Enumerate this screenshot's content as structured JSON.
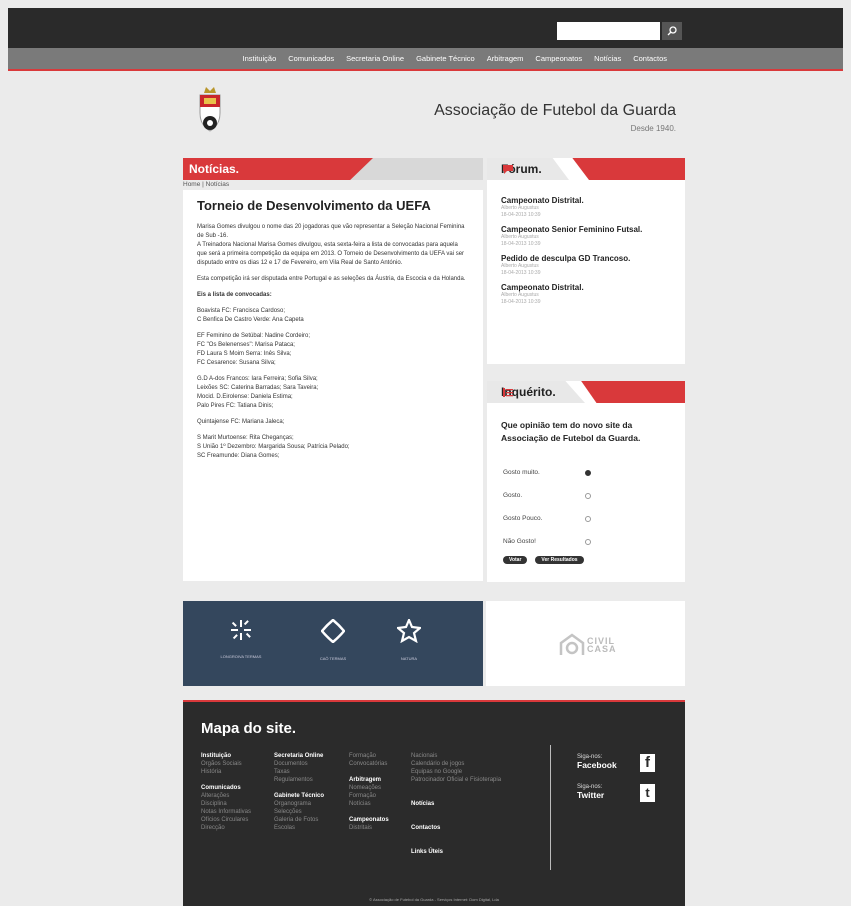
{
  "search": {
    "placeholder": ""
  },
  "nav": [
    "Instituição",
    "Comunicados",
    "Secretaria Online",
    "Gabinete Técnico",
    "Arbitragem",
    "Campeonatos",
    "Notícias",
    "Contactos"
  ],
  "header": {
    "title": "Associação de Futebol da Guarda",
    "subtitle": "Desde 1940."
  },
  "news": {
    "heading": "Notícias.",
    "breadcrumb": "Home | Notícias",
    "article_title": "Torneio de Desenvolvimento da UEFA",
    "paragraphs": [
      "Marisa Gomes divulgou o nome das 20 jogadoras que vão representar a Seleção Nacional Feminina de Sub -16.\nA Treinadora Nacional Marisa Gomes divulgou, esta sexta-feira a lista de convocadas para aquela que será a primeira competição da equipa em 2013. O Torneio de Desenvolvimento da UEFA vai ser disputado entre os dias 12 e 17 de Fevereiro, em Vila Real de Santo António.",
      "Esta competição irá ser disputada entre Portugal e as seleções da Áustria, da Escocia e da Holanda.",
      "Eis a lista de convocadas:",
      "Boavista FC: Francisca Cardoso;\nC Benfica De Castro Verde: Ana Capeta",
      "EF Feminino de Setúbal: Nadine Cordeiro;\nFC \"Os Belenenses\": Marisa Pataca;\nFD Laura S Moim Serra: Inês Silva;\nFC Cesarence: Susana Silva;",
      "G.D A-dos Francos: Iara Ferreira; Sofia Silva;\nLeixões SC: Caterina Barradas; Sara Taveira;\nMocid. D.Eirolense: Daniela Estima;\nPalo Pires FC: Tatiana Dinis;",
      "Quintajense FC: Mariana Jaleca;",
      "S Marit Murtoense: Rita Cheganças;\nS União 1º Dezembro: Margarida Sousa; Patrícia Pelado;\nSC Freamunde: Diana Gomes;"
    ]
  },
  "forum": {
    "heading": "Fórum.",
    "items": [
      {
        "title": "Campeonato Distrital.",
        "author": "Alberto Augustus",
        "date": "18-04-2013 10:39"
      },
      {
        "title": "Campeonato Senior Feminino Futsal.",
        "author": "Alberto Augustus",
        "date": "18-04-2013 10:39"
      },
      {
        "title": "Pedido de desculpa GD Trancoso.",
        "author": "Alberto Augustus",
        "date": "18-04-2013 10:39"
      },
      {
        "title": "Campeonato Distrital.",
        "author": "Alberto Augustus",
        "date": "18-04-2013 10:39"
      }
    ]
  },
  "poll": {
    "heading": "Inquérito.",
    "question": "Que opinião tem do novo site da Associação de Futebol da Guarda.",
    "options": [
      "Gosto muito.",
      "Gosto.",
      "Gosto Pouco.",
      "Não Gosto!"
    ],
    "selected_index": 0,
    "vote_label": "Votar",
    "results_label": "Ver Resultados"
  },
  "sponsors": {
    "left": [
      "LONGROIVA TERMAS",
      "CAÔ TERMAS",
      "NATURA"
    ],
    "right": [
      "CIVIL",
      "CASA"
    ]
  },
  "footer": {
    "title": "Mapa do site.",
    "col1": {
      "h1": "Instituição",
      "l1": [
        "Orgãos Sociais",
        "História"
      ],
      "h2": "Comunicados",
      "l2": [
        "Alterações",
        "Disciplina",
        "Notas Informativas",
        "Ofícios Circulares",
        "Direcção"
      ]
    },
    "col2": {
      "h1": "Secretaria Online",
      "l1": [
        "Documentos",
        "Taxas",
        "Regulamentos"
      ],
      "h2": "Gabinete Técnico",
      "l2": [
        "Organograma",
        "Selecções",
        "Galeria de Fotos",
        "Escolas"
      ]
    },
    "col3": {
      "l0": [
        "Formação",
        "Convocatórias"
      ],
      "h1": "Arbitragem",
      "l1": [
        "Nomeações",
        "Formação",
        "Notícias"
      ],
      "h2": "Campeonatos",
      "l2": [
        "Distritais"
      ]
    },
    "col4": {
      "l0": [
        "Nacionais",
        "Calendário de jogos",
        "Equipas no Google",
        "Patrocinador Oficial e Fisioterapia"
      ],
      "h1": "Notícias",
      "h2": "Contactos",
      "h3": "Links Úteis"
    },
    "social": [
      {
        "label": "Siga-nos:",
        "name": "Facebook",
        "icon": "f"
      },
      {
        "label": "Siga-nos:",
        "name": "Twitter",
        "icon": "t"
      }
    ],
    "copyright": "© Associação de Futebol da Guarda - Serviços Internet: Dom Digital, Lda"
  },
  "colors": {
    "accent": "#d9393b",
    "dark": "#2b2b2b",
    "navy": "#34475d"
  }
}
